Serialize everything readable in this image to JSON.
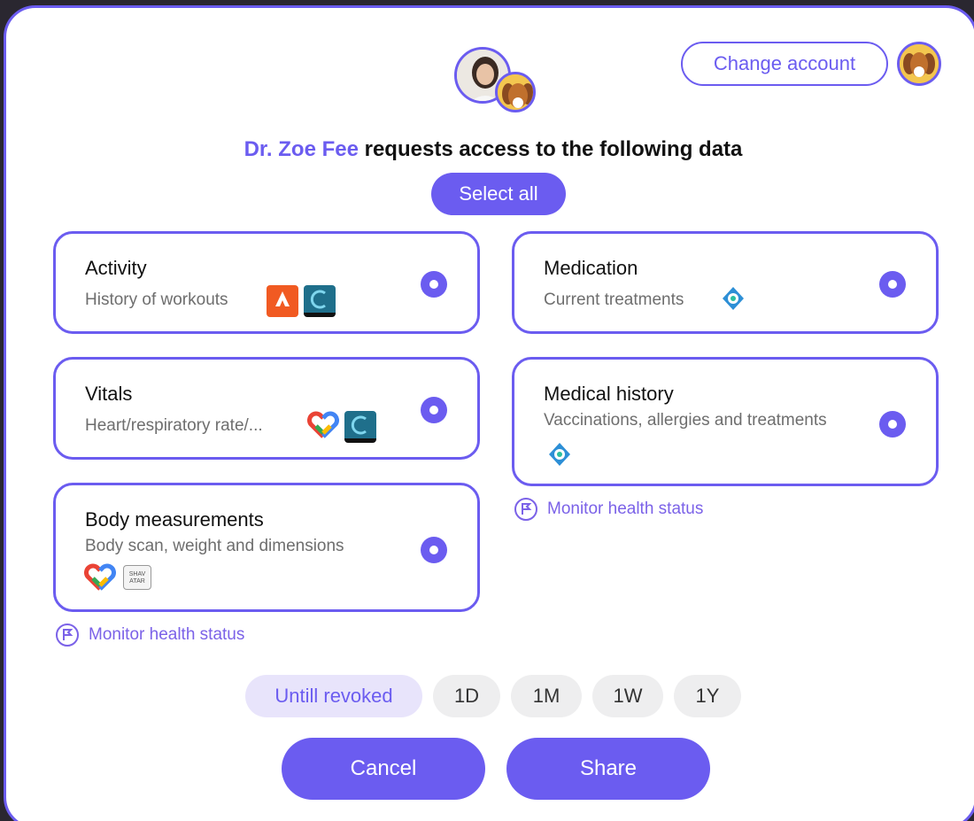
{
  "header": {
    "change_account_label": "Change account",
    "requester_name": "Dr. Zoe Fee",
    "request_text": " requests access to the following data",
    "select_all_label": "Select all"
  },
  "cards": [
    {
      "title": "Activity",
      "subtitle": "History of workouts",
      "sources": [
        "strava-icon",
        "c-app-icon"
      ]
    },
    {
      "title": "Medication",
      "subtitle": "Current treatments",
      "sources": [
        "blue-app-icon"
      ]
    },
    {
      "title": "Vitals",
      "subtitle": "Heart/respiratory rate/...",
      "sources": [
        "google-fit-icon",
        "c-app-icon"
      ]
    },
    {
      "title": "Medical history",
      "subtitle": "Vaccinations, allergies and treatments",
      "sources": [
        "blue-app-icon"
      ]
    },
    {
      "title": "Body measurements",
      "subtitle": "Body scan, weight and dimensions",
      "sources": [
        "google-fit-icon",
        "scan-app-icon"
      ],
      "scan_logo_text": "SHAV ATAR"
    }
  ],
  "monitor_label": "Monitor health status",
  "periods": [
    {
      "label": "Untill revoked",
      "active": true
    },
    {
      "label": "1D",
      "active": false
    },
    {
      "label": "1M",
      "active": false
    },
    {
      "label": "1W",
      "active": false
    },
    {
      "label": "1Y",
      "active": false
    }
  ],
  "actions": {
    "cancel_label": "Cancel",
    "share_label": "Share"
  },
  "colors": {
    "accent": "#6b5cf0",
    "accent_light": "#e8e4fb",
    "muted": "#eeeeef"
  }
}
